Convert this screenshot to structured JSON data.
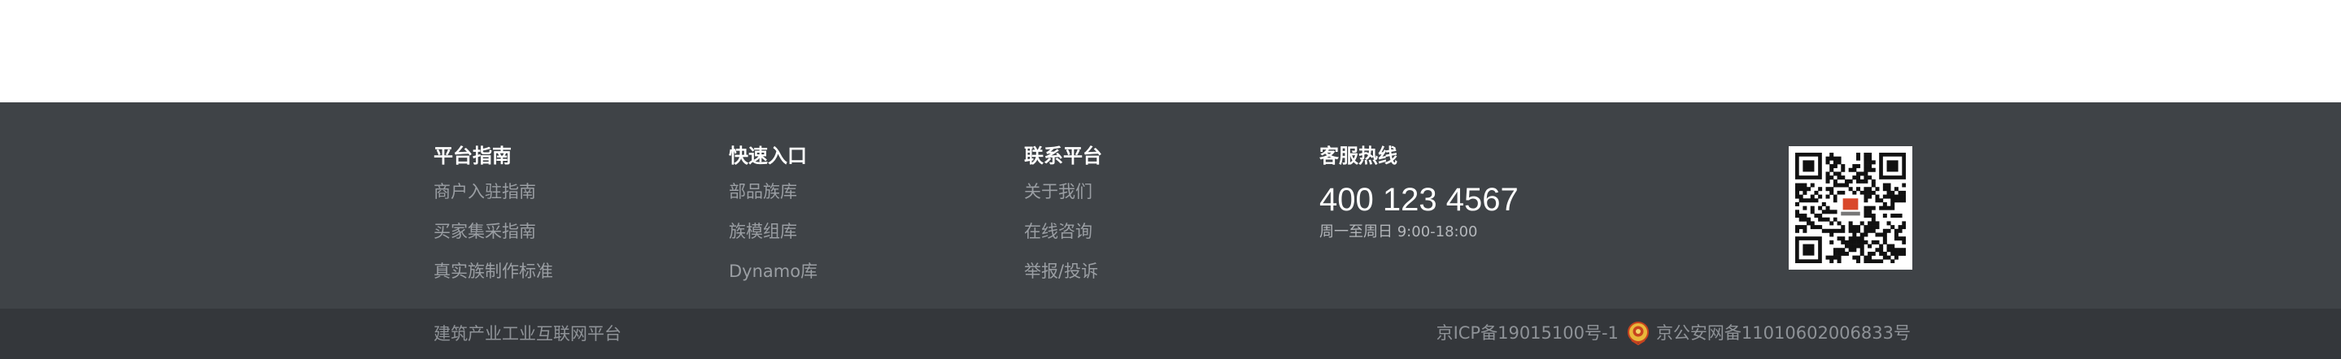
{
  "footer": {
    "columns": [
      {
        "title": "平台指南",
        "links": [
          "商户入驻指南",
          "买家集采指南",
          "真实族制作标准"
        ]
      },
      {
        "title": "快速入口",
        "links": [
          "部品族库",
          "族模组库",
          "Dynamo库"
        ]
      },
      {
        "title": "联系平台",
        "links": [
          "关于我们",
          "在线咨询",
          "举报/投诉"
        ]
      }
    ],
    "hotline": {
      "title": "客服热线",
      "number": "400 123 4567",
      "hours": "周一至周日 9:00-18:00"
    },
    "qr_code": {
      "icon": "qr-code-icon"
    }
  },
  "bottom_bar": {
    "platform_name": "建筑产业工业互联网平台",
    "icp": "京ICP备19015100号-1",
    "police_record": "京公安网备11010602006833号",
    "police_icon": "police-badge-icon"
  },
  "colors": {
    "footer_bg": "#3f4347",
    "bottom_bar_bg": "#34373b",
    "title_text": "#ffffff",
    "link_text": "#9a9ea3"
  }
}
